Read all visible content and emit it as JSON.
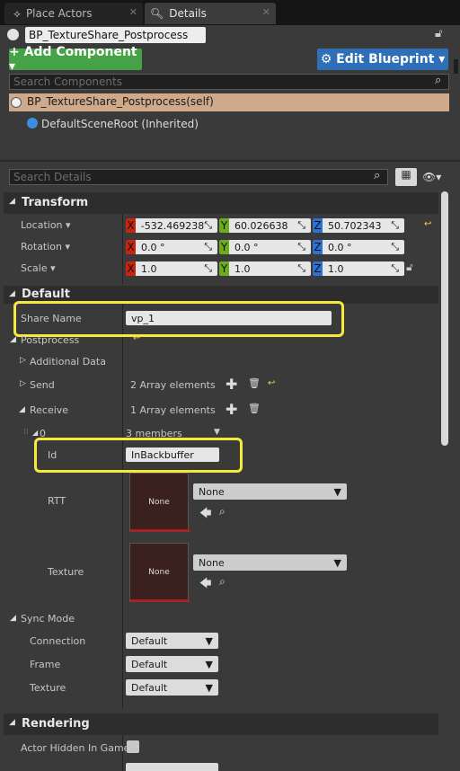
{
  "tabs": [
    {
      "label": "Place Actors"
    },
    {
      "label": "Details"
    }
  ],
  "header": {
    "actor_name": "BP_TextureShare_Postprocess"
  },
  "buttons": {
    "add_component": "+ Add Component ▾",
    "edit_blueprint": "⚙ Edit Blueprint ▾"
  },
  "components": {
    "search_placeholder": "Search Components",
    "self_item": "BP_TextureShare_Postprocess(self)",
    "root_item": "DefaultSceneRoot (Inherited)"
  },
  "details": {
    "search_placeholder": "Search Details"
  },
  "transform": {
    "title": "Transform",
    "location": {
      "label": "Location ▾",
      "x": "-532.469238",
      "y": "60.026638",
      "z": "50.702343"
    },
    "rotation": {
      "label": "Rotation ▾",
      "x": "0.0 °",
      "y": "0.0 °",
      "z": "0.0 °"
    },
    "scale": {
      "label": "Scale ▾",
      "x": "1.0",
      "y": "1.0",
      "z": "1.0"
    },
    "axes": {
      "x": "X",
      "y": "Y",
      "z": "Z"
    }
  },
  "default": {
    "title": "Default",
    "share_name_label": "Share Name",
    "share_name_value": "vp_1",
    "postprocess_label": "Postprocess",
    "additional_data_label": "Additional Data",
    "send_label": "Send",
    "send_value": "2 Array elements",
    "receive_label": "Receive",
    "receive_value": "1 Array elements",
    "element0_label": "0",
    "element0_value": "3 members",
    "id_label": "Id",
    "id_value": "InBackbuffer",
    "rtt_label": "RTT",
    "rtt_swatch": "None",
    "rtt_combo": "None",
    "texture_label": "Texture",
    "texture_swatch": "None",
    "texture_combo": "None"
  },
  "sync": {
    "title": "Sync Mode",
    "connection_label": "Connection",
    "connection_value": "Default",
    "frame_label": "Frame",
    "frame_value": "Default",
    "texture_label": "Texture",
    "texture_value": "Default"
  },
  "rendering": {
    "title": "Rendering",
    "actor_hidden_label": "Actor Hidden In Game"
  }
}
